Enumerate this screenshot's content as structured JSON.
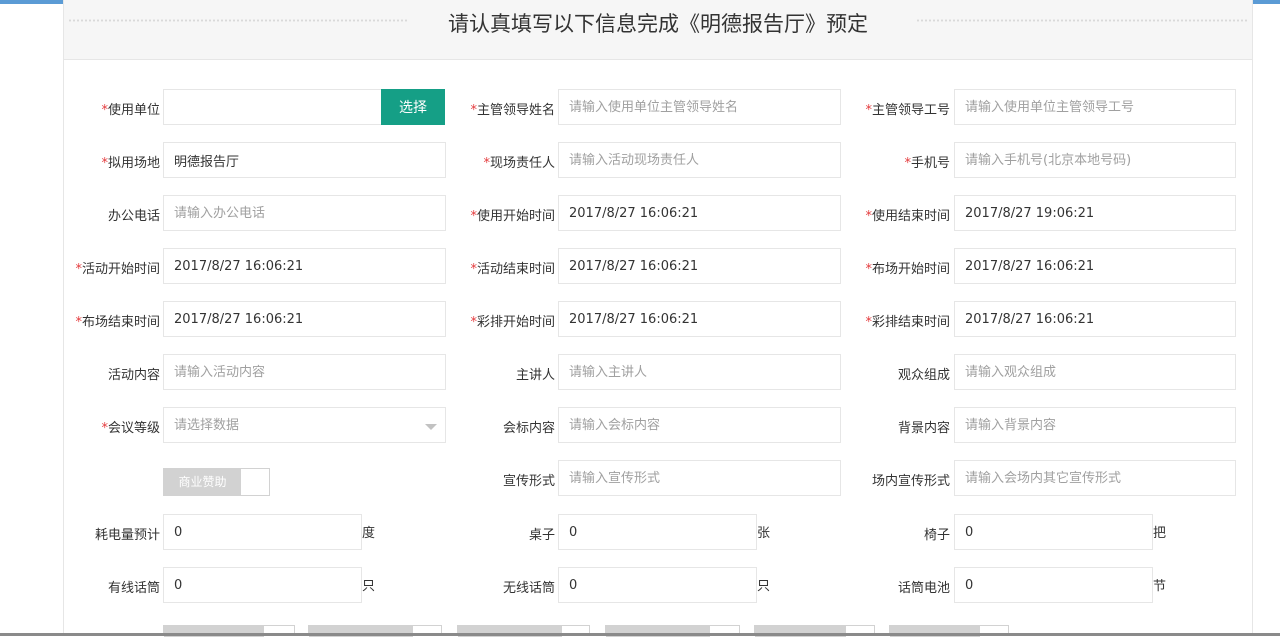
{
  "title": "请认真填写以下信息完成《明德报告厅》预定",
  "colors": {
    "accent": "#159f86",
    "required": "#e4393c",
    "top_bar": "#5b9bd5"
  },
  "form": {
    "row1": {
      "unit_label": "使用单位",
      "unit_value": "",
      "select_button": "选择",
      "leader_name_label": "主管领导姓名",
      "leader_name_placeholder": "请输入使用单位主管领导姓名",
      "leader_id_label": "主管领导工号",
      "leader_id_placeholder": "请输入使用单位主管领导工号"
    },
    "row2": {
      "venue_label": "拟用场地",
      "venue_value": "明德报告厅",
      "onsite_label": "现场责任人",
      "onsite_placeholder": "请输入活动现场责任人",
      "phone_label": "手机号",
      "phone_placeholder": "请输入手机号(北京本地号码)"
    },
    "row3": {
      "office_phone_label": "办公电话",
      "office_phone_placeholder": "请输入办公电话",
      "use_start_label": "使用开始时间",
      "use_start_value": "2017/8/27 16:06:21",
      "use_end_label": "使用结束时间",
      "use_end_value": "2017/8/27 19:06:21"
    },
    "row4": {
      "act_start_label": "活动开始时间",
      "act_start_value": "2017/8/27 16:06:21",
      "act_end_label": "活动结束时间",
      "act_end_value": "2017/8/27 16:06:21",
      "setup_start_label": "布场开始时间",
      "setup_start_value": "2017/8/27 16:06:21"
    },
    "row5": {
      "setup_end_label": "布场结束时间",
      "setup_end_value": "2017/8/27 16:06:21",
      "rehearsal_start_label": "彩排开始时间",
      "rehearsal_start_value": "2017/8/27 16:06:21",
      "rehearsal_end_label": "彩排结束时间",
      "rehearsal_end_value": "2017/8/27 16:06:21"
    },
    "row6": {
      "content_label": "活动内容",
      "content_placeholder": "请输入活动内容",
      "speaker_label": "主讲人",
      "speaker_placeholder": "请输入主讲人",
      "audience_label": "观众组成",
      "audience_placeholder": "请输入观众组成"
    },
    "row7": {
      "level_label": "会议等级",
      "level_placeholder": "请选择数据",
      "logo_label": "会标内容",
      "logo_placeholder": "请输入会标内容",
      "backdrop_label": "背景内容",
      "backdrop_placeholder": "请输入背景内容"
    },
    "row8": {
      "sponsor_switch": "商业赞助",
      "promo_label": "宣传形式",
      "promo_placeholder": "请输入宣传形式",
      "inner_promo_label": "场内宣传形式",
      "inner_promo_placeholder": "请输入会场内其它宣传形式"
    },
    "row9": {
      "power_label": "耗电量预计",
      "power_value": "0",
      "power_unit": "度",
      "tables_label": "桌子",
      "tables_value": "0",
      "tables_unit": "张",
      "chairs_label": "椅子",
      "chairs_value": "0",
      "chairs_unit": "把"
    },
    "row10": {
      "wired_mic_label": "有线话筒",
      "wired_mic_value": "0",
      "wired_mic_unit": "只",
      "wireless_mic_label": "无线话筒",
      "wireless_mic_value": "0",
      "wireless_mic_unit": "只",
      "battery_label": "话筒电池",
      "battery_value": "0",
      "battery_unit": "节"
    }
  }
}
